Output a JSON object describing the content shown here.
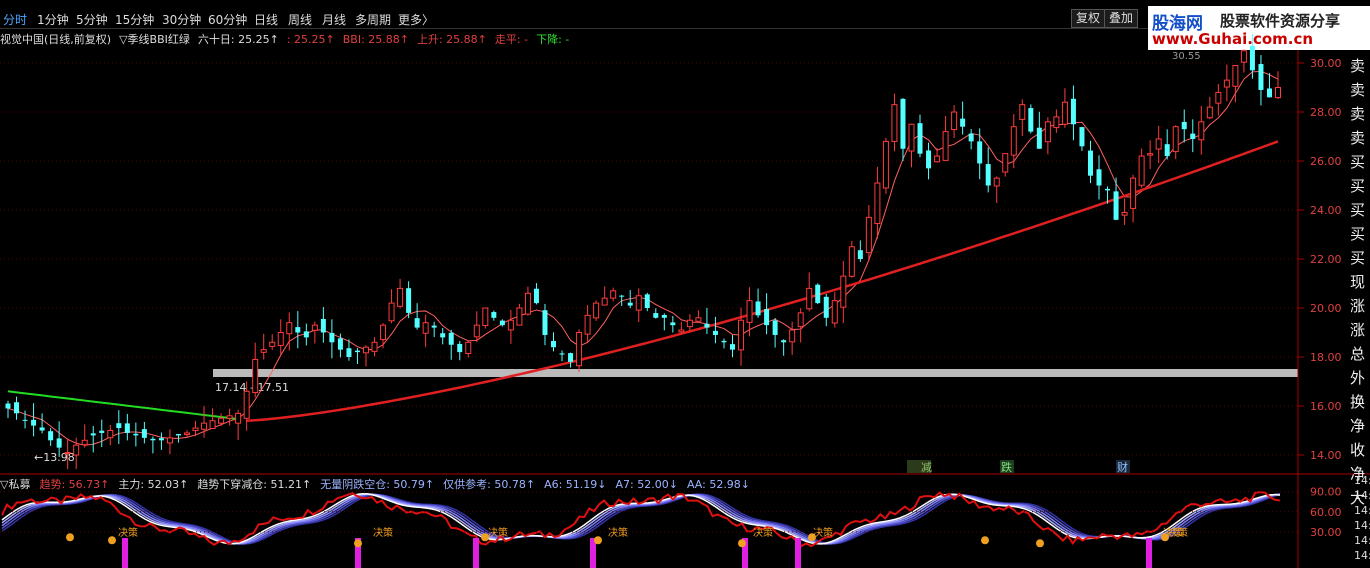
{
  "toolbar": {
    "periods": [
      "分时",
      "1分钟",
      "5分钟",
      "15分钟",
      "30分钟",
      "60分钟",
      "日线",
      "周线",
      "月线",
      "多周期",
      "更多〉"
    ],
    "active_index": 0,
    "buttons": [
      "复权",
      "叠加"
    ]
  },
  "logo": {
    "name": "股海网",
    "tagline": "股票软件资源分享",
    "url": "www.Guhai.com.cn"
  },
  "info_bar": {
    "stock": "视觉中国(日线,前复权)",
    "indicator": "▽季线BBI红绿",
    "sixty": "六十日: 25.25↑",
    "ma_value": ": 25.25↑",
    "bbi": "BBI: 25.88↑",
    "up": "上升: 25.88↑",
    "flat": "走平: -",
    "down": "下降: -"
  },
  "chart_labels": {
    "top_price": "30.55",
    "band_label": "17.14 - 17.51",
    "low_label": "←13.98",
    "events": [
      "减",
      "跌",
      "财"
    ],
    "sub_ind_labels": [
      "决策",
      "决策",
      "决策",
      "决策",
      "决策",
      "决策",
      "决策",
      "决策"
    ]
  },
  "price_axis": {
    "ticks": [
      "30.00",
      "28.00",
      "26.00",
      "24.00",
      "22.00",
      "20.00",
      "18.00",
      "16.00",
      "14.00"
    ]
  },
  "right_column": [
    "卖",
    "卖",
    "卖",
    "卖",
    "买",
    "买",
    "买",
    "买",
    "买",
    "现",
    "涨",
    "涨",
    "总",
    "外",
    "换",
    "净",
    "收",
    "净",
    "大"
  ],
  "lower_panel": {
    "name": "▽私募",
    "qushi": "趋势: 56.73↑",
    "zhuli": "主力: 52.03↑",
    "c1": "趋势下穿减仓: 51.21↑",
    "c2": "无量阴跌空仓: 50.79↑",
    "c3": "仅供参考: 50.78↑",
    "a6": "A6: 51.19↓",
    "a7": "A7: 52.00↓",
    "aa": "AA: 52.98↓",
    "ticks": [
      "90.00",
      "60.00",
      "30.00"
    ],
    "right_ticks": [
      "14:",
      "14:",
      "14:",
      "14:",
      "14:",
      "14:"
    ]
  },
  "chart_data": {
    "type": "candlestick",
    "close": [
      15.9,
      15.7,
      15.4,
      15.2,
      15.0,
      14.6,
      14.3,
      14.1,
      14.4,
      14.6,
      14.8,
      14.9,
      15.0,
      15.1,
      14.9,
      14.8,
      14.7,
      14.6,
      14.6,
      14.7,
      14.8,
      14.9,
      15.1,
      15.3,
      15.4,
      15.5,
      15.6,
      15.7,
      16.6,
      17.9,
      18.3,
      18.6,
      19.0,
      19.4,
      19.0,
      18.8,
      19.3,
      19.0,
      18.6,
      18.3,
      18.0,
      18.2,
      18.4,
      18.6,
      19.3,
      20.2,
      20.8,
      19.8,
      19.2,
      19.4,
      19.2,
      18.8,
      18.5,
      18.2,
      18.6,
      19.3,
      20.0,
      19.6,
      19.3,
      19.5,
      20.0,
      20.6,
      20.2,
      18.9,
      18.4,
      18.1,
      17.8,
      19.0,
      19.7,
      20.2,
      20.4,
      20.7,
      20.5,
      20.1,
      20.5,
      20.0,
      19.6,
      19.6,
      19.3,
      19.1,
      19.5,
      19.6,
      19.2,
      18.9,
      18.6,
      18.3,
      19.5,
      20.3,
      19.7,
      19.3,
      18.9,
      18.6,
      19.1,
      19.8,
      20.8,
      20.2,
      19.6,
      20.3,
      21.3,
      22.5,
      22.0,
      23.7,
      25.1,
      26.8,
      28.3,
      26.5,
      27.5,
      26.3,
      25.7,
      26.2,
      27.2,
      28.0,
      27.4,
      26.8,
      25.9,
      25.0,
      25.3,
      26.3,
      27.4,
      28.3,
      27.2,
      26.5,
      27.6,
      27.8,
      28.4,
      27.5,
      26.6,
      25.4,
      25.0,
      24.8,
      23.6,
      23.9,
      25.3,
      26.2,
      26.3,
      26.9,
      26.2,
      27.4,
      27.3,
      26.9,
      27.6,
      28.2,
      28.8,
      29.3,
      29.9,
      30.5,
      29.7,
      28.9,
      28.6,
      29.0
    ]
  }
}
